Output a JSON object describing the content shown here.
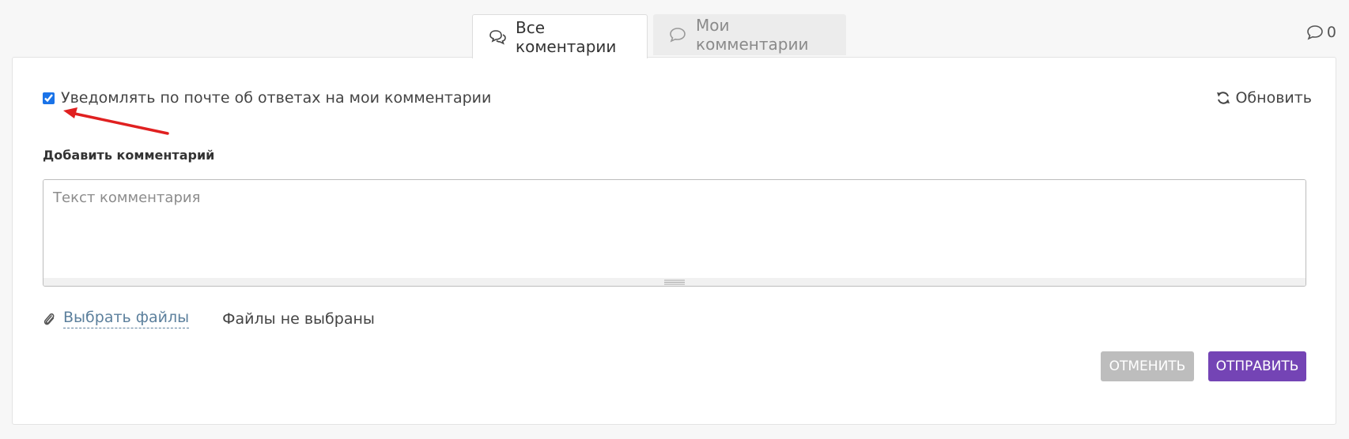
{
  "tabs": {
    "all": {
      "label": "Все коментарии",
      "icon": "comments-icon"
    },
    "mine": {
      "label": "Мои комментарии",
      "icon": "comment-icon"
    }
  },
  "comment_count": {
    "value": "0",
    "icon": "comment-icon"
  },
  "notify": {
    "label": "Уведомлять по почте об ответах на мои комментарии",
    "checked": true
  },
  "refresh": {
    "label": "Обновить",
    "icon": "refresh-icon"
  },
  "add_comment": {
    "label": "Добавить комментарий",
    "placeholder": "Текст комментария",
    "value": ""
  },
  "files": {
    "choose_label": "Выбрать файлы",
    "status": "Файлы не выбраны",
    "icon": "paperclip-icon"
  },
  "buttons": {
    "cancel": "Отменить",
    "send": "Отправить"
  },
  "colors": {
    "accent": "#7444b5",
    "cancel": "#bdbdbd",
    "link": "#5b7f9c",
    "annotation_arrow": "#e02020"
  }
}
